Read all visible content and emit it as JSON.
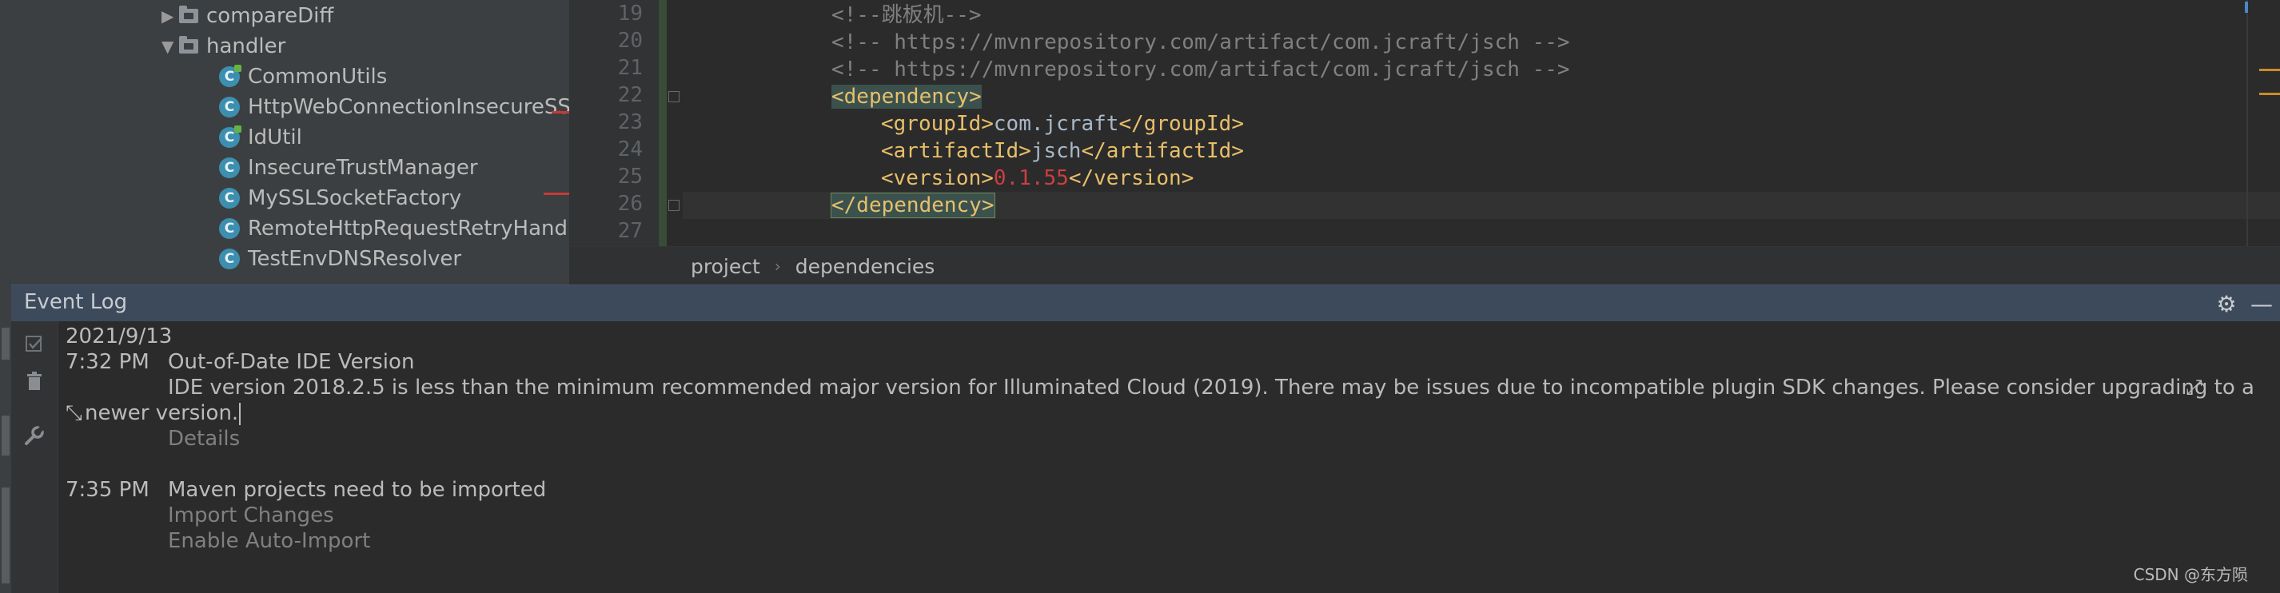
{
  "project_tree": {
    "items": [
      {
        "label": "compareDiff",
        "type": "folder",
        "expanded": false
      },
      {
        "label": "handler",
        "type": "folder",
        "expanded": true
      },
      {
        "label": "CommonUtils",
        "type": "class",
        "icon": "C"
      },
      {
        "label": "HttpWebConnectionInsecureSSL",
        "type": "class",
        "icon": "C"
      },
      {
        "label": "IdUtil",
        "type": "class",
        "icon": "C"
      },
      {
        "label": "InsecureTrustManager",
        "type": "class",
        "icon": "C"
      },
      {
        "label": "MySSLSocketFactory",
        "type": "class",
        "icon": "C"
      },
      {
        "label": "RemoteHttpRequestRetryHandle",
        "type": "class",
        "icon": "C"
      },
      {
        "label": "TestEnvDNSResolver",
        "type": "class",
        "icon": "C"
      }
    ]
  },
  "editor": {
    "line_numbers": [
      "19",
      "20",
      "21",
      "22",
      "23",
      "24",
      "25",
      "26",
      "27"
    ],
    "lines": {
      "l19": {
        "comment": "<!--跳板机-->"
      },
      "l20": {
        "comment": "<!-- https://mvnrepository.com/artifact/com.jcraft/jsch -->"
      },
      "l21": {
        "comment": "<!-- https://mvnrepository.com/artifact/com.jcraft/jsch -->"
      },
      "l22": {
        "open": "<dependency>"
      },
      "l23": {
        "open": "<groupId>",
        "text": "com.jcraft",
        "close": "</groupId>"
      },
      "l24": {
        "open": "<artifactId>",
        "text": "jsch",
        "close": "</artifactId>"
      },
      "l25": {
        "open": "<version>",
        "text": "0.1.55",
        "close": "</version>"
      },
      "l26": {
        "close": "</dependency>"
      }
    }
  },
  "breadcrumb": {
    "items": [
      "project",
      "dependencies"
    ],
    "separator": "›"
  },
  "event_log": {
    "title": "Event Log",
    "date": "2021/9/13",
    "entries": [
      {
        "time": "7:32 PM",
        "title": "Out-of-Date IDE Version",
        "message_line1": "IDE version 2018.2.5 is less than the minimum recommended major version for Illuminated Cloud (2019). There may be issues due to incompatible plugin SDK changes. Please consider upgrading to a",
        "message_line2": "newer version.",
        "links": [
          "Details"
        ]
      },
      {
        "time": "7:35 PM",
        "title": "Maven projects need to be imported",
        "links": [
          "Import Changes",
          "Enable Auto-Import"
        ]
      }
    ]
  },
  "watermark": "CSDN @东方陨",
  "colors": {
    "tag": "#e8bf6a",
    "comment": "#808080",
    "number": "#cc3f3f",
    "class_icon": "#3d8fb0",
    "header": "#3c4a5c"
  }
}
